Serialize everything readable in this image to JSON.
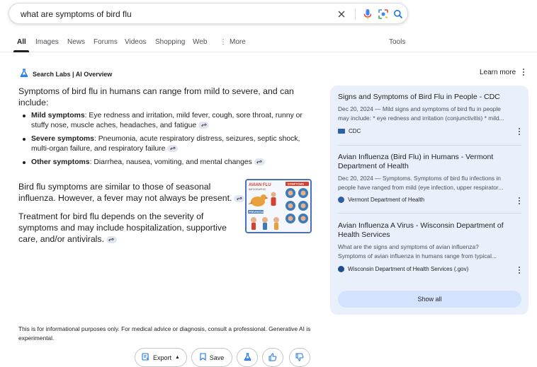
{
  "search": {
    "query": "what are symptoms of bird flu",
    "icons": [
      "clear-icon",
      "mic-icon",
      "lens-icon",
      "search-icon"
    ]
  },
  "tabs": {
    "items": [
      "All",
      "Images",
      "News",
      "Forums",
      "Videos",
      "Shopping",
      "Web",
      "More"
    ],
    "active": "All",
    "tools": "Tools"
  },
  "ai_overview": {
    "header": "Search Labs | AI Overview",
    "learn_more": "Learn more",
    "intro": "Symptoms of bird flu in humans can range from mild to severe, and can include:",
    "bullets": [
      {
        "term": "Mild symptoms",
        "text": ": Eye redness and irritation, mild fever, cough, sore throat, runny or stuffy nose, muscle aches, headaches, and fatigue"
      },
      {
        "term": "Severe symptoms",
        "text": ": Pneumonia, acute respiratory distress, seizures, septic shock, multi-organ failure, and respiratory failure"
      },
      {
        "term": "Other symptoms",
        "text": ": Diarrhea, nausea, vomiting, and mental changes"
      }
    ],
    "para1": "Bird flu symptoms are similar to those of seasonal influenza. However, a fever may not always be present.",
    "para2": "Treatment for bird flu depends on the severity of symptoms and may include hospitalization, supportive care, and/or antivirals.",
    "infographic": {
      "title": "AVIAN FLU",
      "subtitle": "INFOGRAPHIC",
      "symptoms_label": "SYMPTOMS",
      "prevention_label": "PREVENTION"
    }
  },
  "sources": {
    "items": [
      {
        "title": "Signs and Symptoms of Bird Flu in People - CDC",
        "snippet1": "Dec 20, 2024 — Mild signs and symptoms of bird flu in people",
        "snippet2": "may include: * eye redness and irritation (conjunctivitis) * mild...",
        "site": "CDC"
      },
      {
        "title": "Avian Influenza (Bird Flu) in Humans - Vermont Department of Health",
        "snippet1": "Dec 20, 2024 — Symptoms. Symptoms of bird flu infections in",
        "snippet2": "people have ranged from mild (eye infection, upper respirator...",
        "site": "Vermont Department of Health"
      },
      {
        "title": "Avian Influenza A Virus - Wisconsin Department of Health Services",
        "snippet1": "What are the signs and symptoms of avian influenza?",
        "snippet2": "Symptoms of avian influenza in humans range from typical...",
        "site": "Wisconsin Department of Health Services (.gov)"
      }
    ],
    "show_all": "Show all"
  },
  "disclaimer": "This is for informational purposes only. For medical advice or diagnosis, consult a professional. Generative AI is experimental.",
  "actions": {
    "export": "Export",
    "save": "Save"
  },
  "colors": {
    "panel_bg": "#eaf0fb",
    "show_all_bg": "#d3e3fd",
    "accent_blue": "#1a73e8",
    "link_chip": "#dfe5f1"
  }
}
